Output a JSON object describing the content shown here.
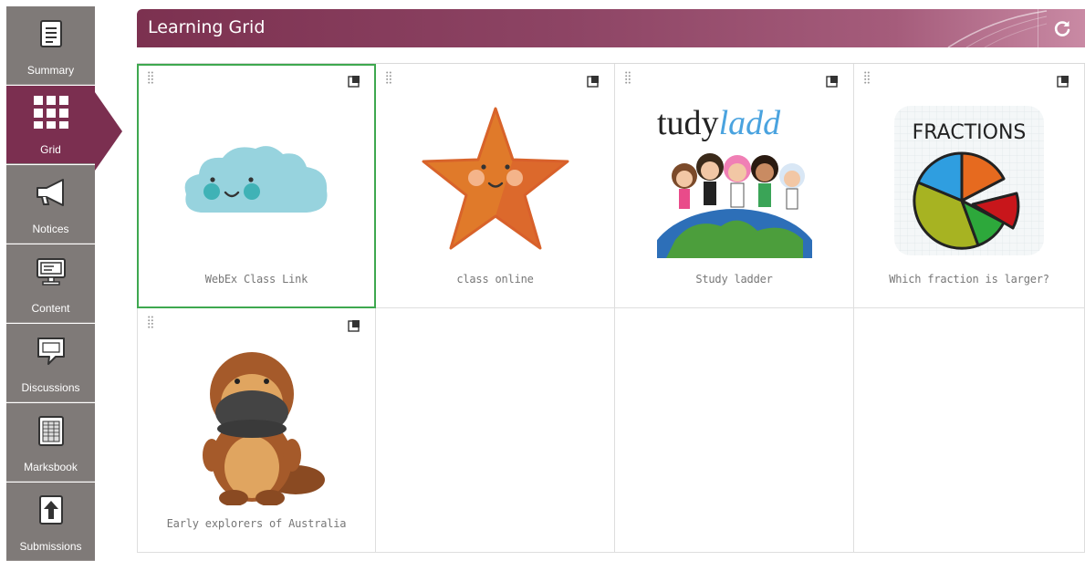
{
  "sidebar": {
    "items": [
      {
        "label": "Summary",
        "icon": "document-icon"
      },
      {
        "label": "Grid",
        "icon": "grid-icon",
        "active": true
      },
      {
        "label": "Notices",
        "icon": "megaphone-icon"
      },
      {
        "label": "Content",
        "icon": "monitor-icon"
      },
      {
        "label": "Discussions",
        "icon": "speech-bubble-icon"
      },
      {
        "label": "Marksbook",
        "icon": "notebook-icon"
      },
      {
        "label": "Submissions",
        "icon": "upload-icon"
      }
    ]
  },
  "header": {
    "title": "Learning Grid",
    "refresh_icon": "refresh-icon"
  },
  "grid": {
    "tiles": [
      {
        "label": "WebEx Class Link",
        "image": "cloud-image",
        "selected": true
      },
      {
        "label": "class online",
        "image": "star-image"
      },
      {
        "label": "Study ladder",
        "image": "studyladder-image",
        "image_text": "tudyladd"
      },
      {
        "label": "Which fraction is larger?",
        "image": "fractions-pie-image",
        "image_text": "FRACTIONS"
      },
      {
        "label": "Early explorers of Australia",
        "image": "platypus-image"
      }
    ]
  },
  "colors": {
    "accent": "#7b2f50",
    "sidebar_bg": "#7f7a78",
    "selected_border": "#3ea84f",
    "label_text": "#777777"
  }
}
